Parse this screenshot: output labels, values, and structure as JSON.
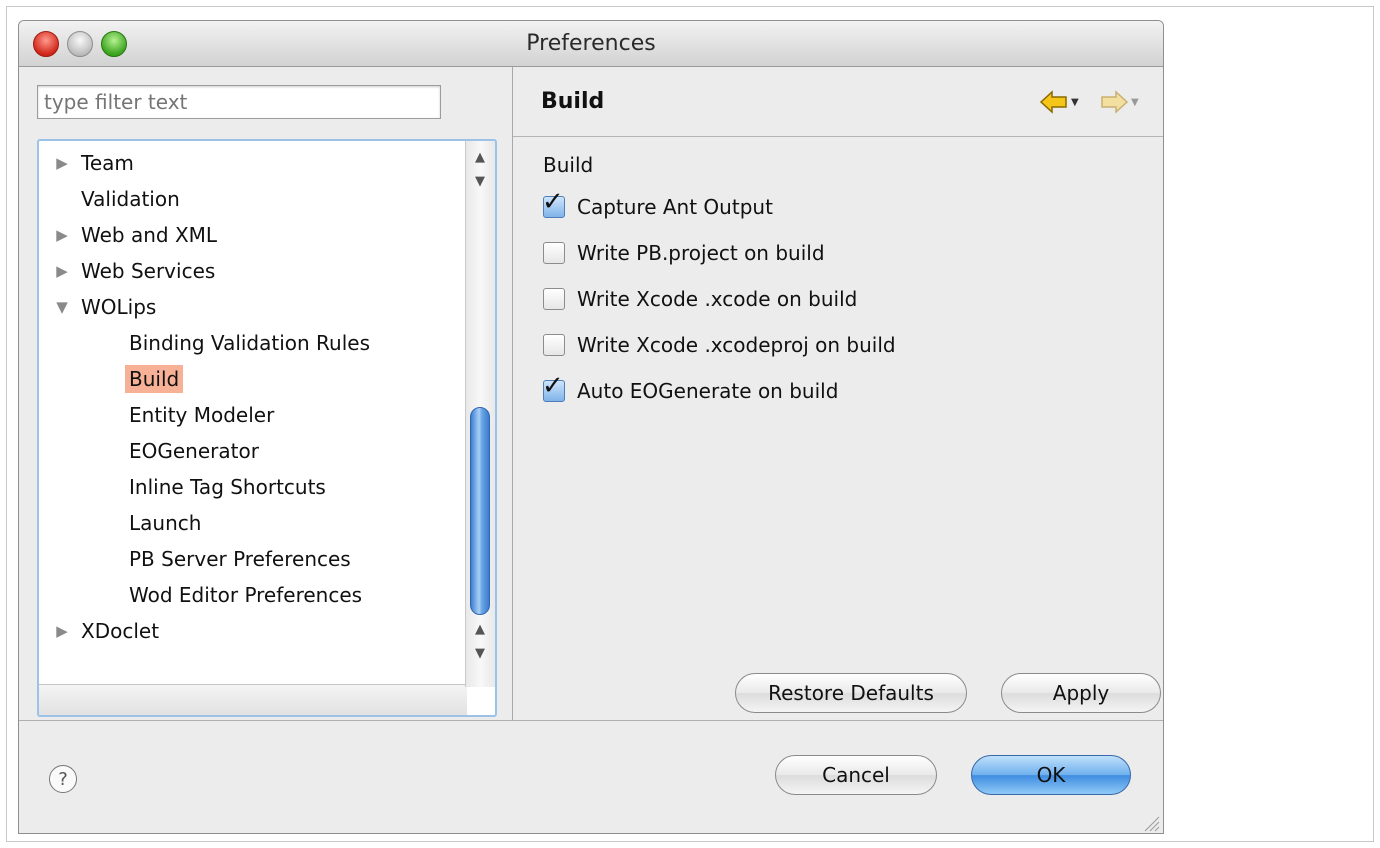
{
  "window": {
    "title": "Preferences"
  },
  "filter": {
    "placeholder": "type filter text"
  },
  "tree": {
    "items": [
      {
        "label": "Team",
        "arrow": "collapsed",
        "indent": 0
      },
      {
        "label": "Validation",
        "arrow": "none",
        "indent": 0
      },
      {
        "label": "Web and XML",
        "arrow": "collapsed",
        "indent": 0
      },
      {
        "label": "Web Services",
        "arrow": "collapsed",
        "indent": 0
      },
      {
        "label": "WOLips",
        "arrow": "expanded",
        "indent": 0
      },
      {
        "label": "Binding Validation Rules",
        "arrow": "none",
        "indent": 1
      },
      {
        "label": "Build",
        "arrow": "none",
        "indent": 1,
        "selected": true
      },
      {
        "label": "Entity Modeler",
        "arrow": "none",
        "indent": 1
      },
      {
        "label": "EOGenerator",
        "arrow": "none",
        "indent": 1
      },
      {
        "label": "Inline Tag Shortcuts",
        "arrow": "none",
        "indent": 1
      },
      {
        "label": "Launch",
        "arrow": "none",
        "indent": 1
      },
      {
        "label": "PB Server Preferences",
        "arrow": "none",
        "indent": 1
      },
      {
        "label": "Wod Editor Preferences",
        "arrow": "none",
        "indent": 1
      },
      {
        "label": "XDoclet",
        "arrow": "collapsed",
        "indent": 0
      }
    ]
  },
  "page": {
    "title": "Build",
    "group_label": "Build",
    "options": [
      {
        "label": "Capture Ant Output",
        "checked": true
      },
      {
        "label": "Write PB.project on build",
        "checked": false
      },
      {
        "label": "Write Xcode .xcode on build",
        "checked": false
      },
      {
        "label": "Write Xcode .xcodeproj on build",
        "checked": false
      },
      {
        "label": "Auto EOGenerate on build",
        "checked": true
      }
    ],
    "restore_defaults_label": "Restore Defaults",
    "apply_label": "Apply"
  },
  "footer": {
    "help_glyph": "?",
    "cancel_label": "Cancel",
    "ok_label": "OK"
  },
  "colors": {
    "selection": "#f6b197",
    "nav_arrow_active": "#f5c518",
    "nav_arrow_inactive": "#f3dfa0",
    "default_button": "#3f8ce0"
  }
}
